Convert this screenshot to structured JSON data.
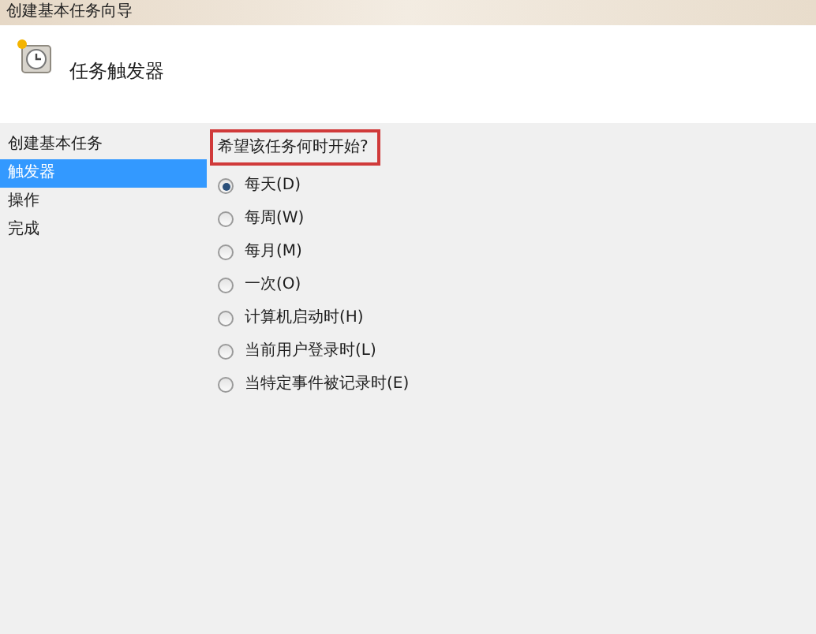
{
  "window": {
    "title": "创建基本任务向导"
  },
  "header": {
    "title": "任务触发器"
  },
  "sidebar": {
    "items": [
      {
        "label": "创建基本任务",
        "selected": false
      },
      {
        "label": "触发器",
        "selected": true
      },
      {
        "label": "操作",
        "selected": false
      },
      {
        "label": "完成",
        "selected": false
      }
    ]
  },
  "question": "希望该任务何时开始?",
  "options": [
    {
      "label": "每天(D)",
      "selected": true
    },
    {
      "label": "每周(W)",
      "selected": false
    },
    {
      "label": "每月(M)",
      "selected": false
    },
    {
      "label": "一次(O)",
      "selected": false
    },
    {
      "label": "计算机启动时(H)",
      "selected": false
    },
    {
      "label": "当前用户登录时(L)",
      "selected": false
    },
    {
      "label": "当特定事件被记录时(E)",
      "selected": false
    }
  ]
}
